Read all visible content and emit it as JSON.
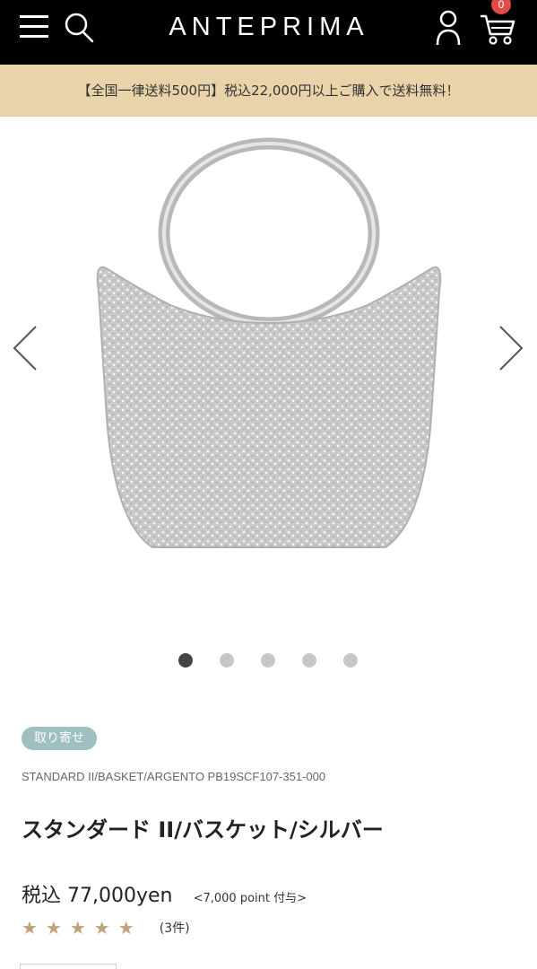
{
  "header": {
    "brand": "ANTEPRIMA",
    "cart_count": "0",
    "icons": [
      "menu-icon",
      "search-icon",
      "user-icon",
      "cart-icon"
    ]
  },
  "shipping_banner": "【全国一律送料500円】税込22,000円以上ご購入で送料無料！",
  "gallery": {
    "slide_count": 5,
    "active_index": 0,
    "image_subject": "silver wire basket handbag",
    "bag_color": "#c9c9cb"
  },
  "product": {
    "tag": "取り寄せ",
    "sku": "STANDARD II/BASKET/ARGENTO  PB19SCF107-351-000",
    "title": "スタンダード II/バスケット/シルバー",
    "price": "税込 77,000yen",
    "points": "<7,000 point 付与>",
    "rating": 5,
    "stars": "★★★★★",
    "review_count": "(3件)"
  },
  "colors": {
    "topbar": "#000000",
    "banner": "#e8d3aa",
    "tag": "#9fbfc0",
    "star": "#c0a27a",
    "cart_badge": "#e14b48"
  }
}
